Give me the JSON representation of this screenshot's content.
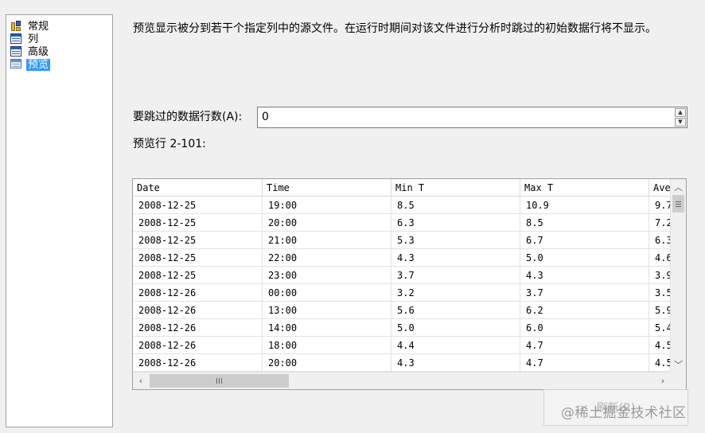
{
  "nav": {
    "items": [
      {
        "label": "常规",
        "icon": "general-icon",
        "selected": false
      },
      {
        "label": "列",
        "icon": "columns-icon",
        "selected": false
      },
      {
        "label": "高级",
        "icon": "advanced-icon",
        "selected": false
      },
      {
        "label": "预览",
        "icon": "preview-icon",
        "selected": true
      }
    ]
  },
  "description": "预览显示被分到若干个指定列中的源文件。在运行时期间对该文件进行分析时跳过的初始数据行将不显示。",
  "skip": {
    "label": "要跳过的数据行数(A):",
    "value": "0"
  },
  "preview_label": "预览行 2-101:",
  "grid": {
    "columns": [
      "Date",
      "Time",
      "Min T",
      "Max T",
      "Ave"
    ],
    "rows": [
      [
        "2008-12-25",
        "19:00",
        "8.5",
        "10.9",
        "9.7"
      ],
      [
        "2008-12-25",
        "20:00",
        "6.3",
        "8.5",
        "7.2"
      ],
      [
        "2008-12-25",
        "21:00",
        "5.3",
        "6.7",
        "6.3"
      ],
      [
        "2008-12-25",
        "22:00",
        "4.3",
        "5.0",
        "4.6"
      ],
      [
        "2008-12-25",
        "23:00",
        "3.7",
        "4.3",
        "3.9"
      ],
      [
        "2008-12-26",
        "00:00",
        "3.2",
        "3.7",
        "3.5"
      ],
      [
        "2008-12-26",
        "13:00",
        "5.6",
        "6.2",
        "5.9"
      ],
      [
        "2008-12-26",
        "14:00",
        "5.0",
        "6.0",
        "5.4"
      ],
      [
        "2008-12-26",
        "18:00",
        "4.4",
        "4.7",
        "4.5"
      ],
      [
        "2008-12-26",
        "20:00",
        "4.3",
        "4.7",
        "4.5"
      ]
    ]
  },
  "button_ghost_label": "刷新(R)",
  "watermark": "@稀土掘金技术社区"
}
